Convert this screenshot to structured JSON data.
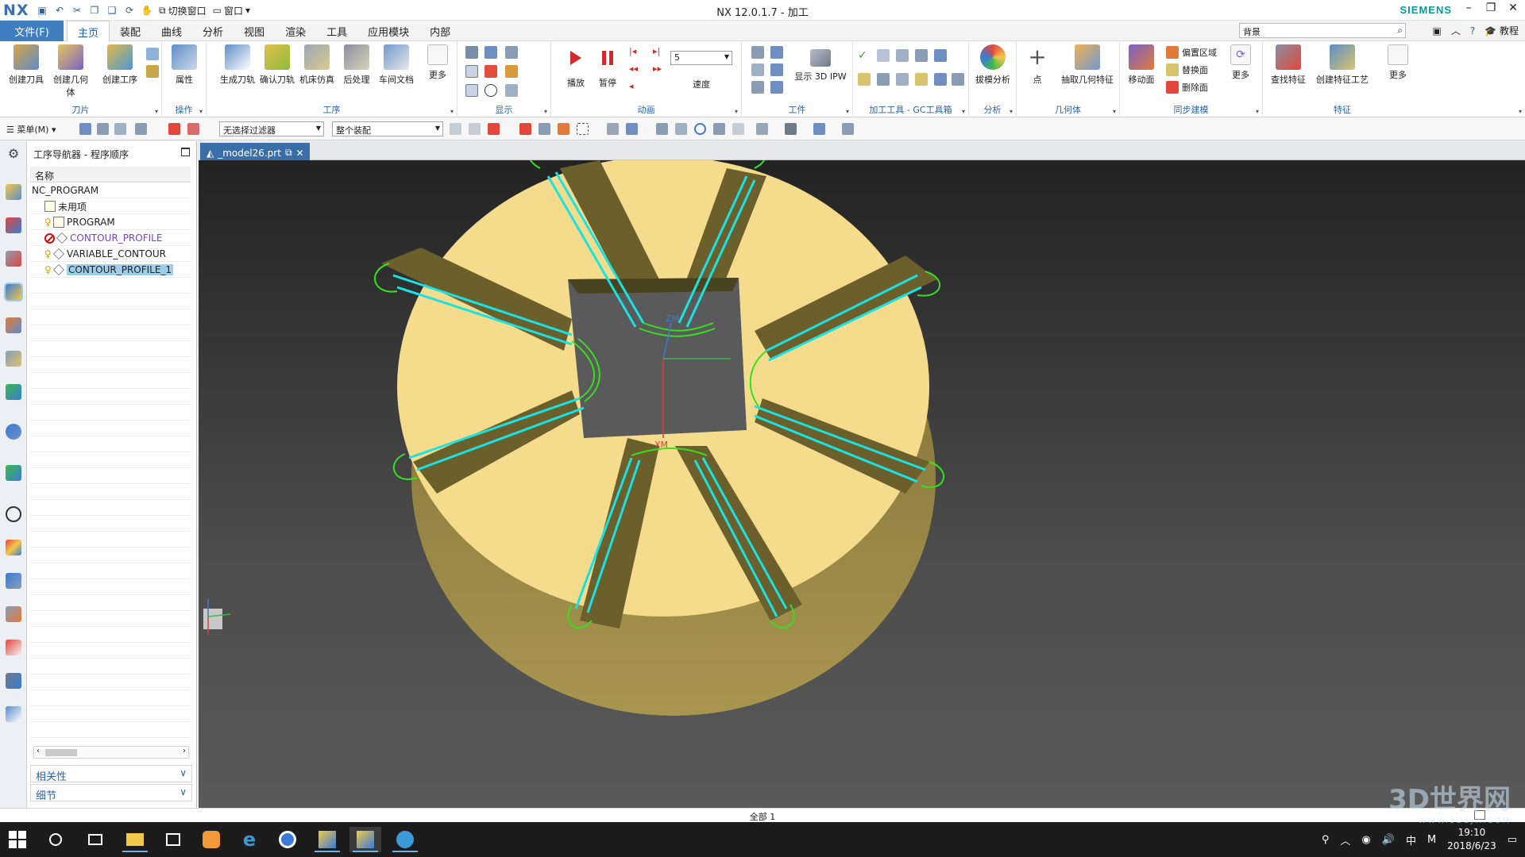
{
  "app": {
    "logo": "NX",
    "title": "NX 12.0.1.7 - 加工",
    "brand": "SIEMENS",
    "switch_window": "切换窗口",
    "window_menu": "窗口"
  },
  "menu": {
    "file": "文件(F)",
    "tabs": [
      "主页",
      "装配",
      "曲线",
      "分析",
      "视图",
      "渲染",
      "工具",
      "应用模块",
      "内部"
    ],
    "search_value": "背景",
    "learn": "教程"
  },
  "ribbon": {
    "groups": {
      "blade": "刀片",
      "ops": "操作",
      "process": "工序",
      "display": "显示",
      "animation": "动画",
      "workpiece": "工件",
      "gc": "加工工具 - GC工具箱",
      "analysis": "分析",
      "geometry": "几何体",
      "sync": "同步建模",
      "feature": "特征"
    },
    "buttons": {
      "create_tool": "创建刀具",
      "create_geometry": "创建几何体",
      "create_operation": "创建工序",
      "properties": "属性",
      "generate_toolpath": "生成刀轨",
      "verify_toolpath": "确认刀轨",
      "machine_sim": "机床仿真",
      "postprocess": "后处理",
      "shop_doc": "车间文档",
      "more": "更多",
      "play": "播放",
      "pause": "暂停",
      "speed_label": "速度",
      "speed_value": "5",
      "show_3d_ipw": "显示 3D IPW",
      "draft_analysis": "拔模分析",
      "point": "点",
      "extract_geometry": "抽取几何特征",
      "move_face": "移动面",
      "offset_region": "偏置区域",
      "replace_face": "替换面",
      "delete_face": "删除面",
      "find_feature": "查找特征",
      "create_feature_process": "创建特征工艺"
    }
  },
  "toolbar2": {
    "menu": "菜单(M)",
    "filter": "无选择过滤器",
    "scope": "整个装配"
  },
  "navigator": {
    "title": "工序导航器 - 程序顺序",
    "column_header": "名称",
    "rows": [
      {
        "label": "NC_PROGRAM",
        "indent": 0
      },
      {
        "label": "未用项",
        "indent": 1
      },
      {
        "label": "PROGRAM",
        "indent": 1
      },
      {
        "label": "CONTOUR_PROFILE",
        "indent": 1,
        "color": "#7a3ed6"
      },
      {
        "label": "VARIABLE_CONTOUR",
        "indent": 1
      },
      {
        "label": "CONTOUR_PROFILE_1",
        "indent": 1,
        "selected": true
      }
    ],
    "section_related": "相关性",
    "section_details": "细节"
  },
  "document": {
    "tab": "_model26.prt"
  },
  "viewport": {
    "wcs_x": "XM",
    "wcs_z": "ZM"
  },
  "status": {
    "text": "全部 1"
  },
  "taskbar": {
    "time": "19:10",
    "date": "2018/6/23",
    "ime": "中",
    "watermark": "3D世界网",
    "watermark_url": "WWW.3DSJW.COM"
  },
  "colors": {
    "accent": "#3f7fc0",
    "part_top": "#f5dc8c",
    "part_side": "#8a7a3c",
    "toolpath_cyan": "#19e2e2",
    "toolpath_green": "#36e01e"
  }
}
